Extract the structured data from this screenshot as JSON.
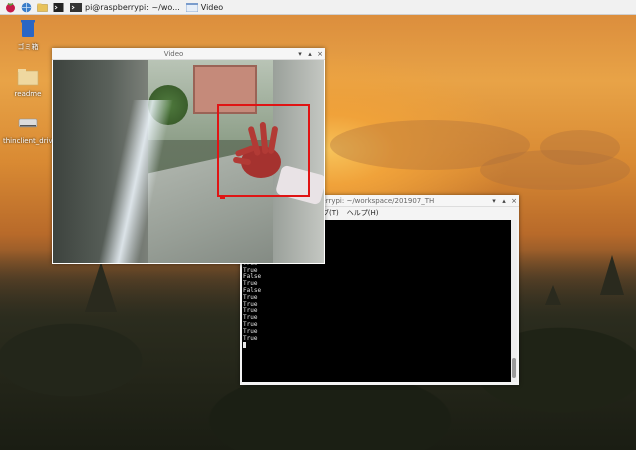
{
  "taskbar": {
    "task1_label": "pi@raspberrypi: ~/wo...",
    "task2_label": "Video"
  },
  "desktop": {
    "icons": [
      {
        "label": "ゴミ箱"
      },
      {
        "label": "readme"
      },
      {
        "label": "thinclient_drives"
      }
    ]
  },
  "video_window": {
    "title": "Video"
  },
  "terminal_window": {
    "title": "@raspberrypi: ~/workspace/201907_TH",
    "menu": [
      "ブ(T)",
      "ヘルプ(H)"
    ],
    "lines": [
      "True",
      "True",
      "True",
      "False",
      "True",
      "False",
      "True",
      "True",
      "False",
      "True",
      "False",
      "True",
      "True",
      "True",
      "True",
      "True",
      "True",
      "True"
    ]
  }
}
